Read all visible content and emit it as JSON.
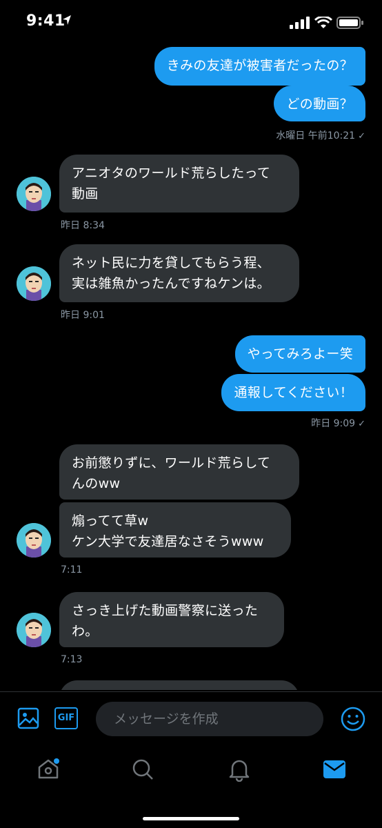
{
  "status_bar": {
    "time": "9:41"
  },
  "colors": {
    "accent": "#1d9bf0",
    "incoming": "#2f3336",
    "meta": "#8b98a5"
  },
  "messages": [
    {
      "direction": "out",
      "text": "きみの友達が被害者だったの？"
    },
    {
      "direction": "out",
      "text": "どの動画？"
    },
    {
      "direction": "meta",
      "text": "水曜日 午前10:21"
    },
    {
      "direction": "in",
      "text": "アニオタのワールド荒らしたって\n動画"
    },
    {
      "direction": "meta",
      "text": "昨日 8:34"
    },
    {
      "direction": "in",
      "text": "ネット民に力を貸してもらう程、\n実は雑魚かったんですねケンは。"
    },
    {
      "direction": "meta",
      "text": "昨日 9:01"
    },
    {
      "direction": "out",
      "text": "やってみろよー笑"
    },
    {
      "direction": "out",
      "text": "通報してください！"
    },
    {
      "direction": "meta",
      "text": "昨日 9:09"
    },
    {
      "direction": "in",
      "text": "お前懲りずに、ワールド荒らして\nんのww"
    },
    {
      "direction": "in",
      "text": "煽ってて草w\nケン大学で友達居なさそうwww"
    },
    {
      "direction": "meta",
      "text": "7:11"
    },
    {
      "direction": "in",
      "text": "さっき上げた動画警察に送った\nわ。"
    },
    {
      "direction": "meta",
      "text": "7:13"
    }
  ],
  "composer": {
    "gif_label": "GIF",
    "placeholder": "メッセージを作成",
    "icons": [
      "image-icon",
      "gif-icon",
      "emoji-icon"
    ]
  },
  "tabbar": {
    "items": [
      "home-icon",
      "search-icon",
      "notifications-icon",
      "messages-icon"
    ],
    "active": "messages-icon"
  }
}
